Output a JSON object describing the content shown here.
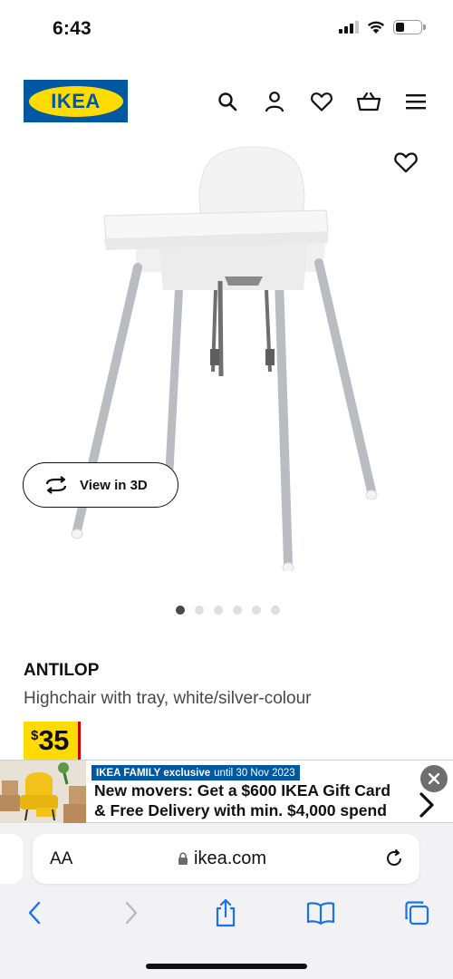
{
  "status_bar": {
    "time": "6:43",
    "icons": [
      "cellular-signal-icon",
      "wifi-icon",
      "battery-icon"
    ],
    "battery_level": 0.35
  },
  "header": {
    "logo_text": "IKEA",
    "logo_colors": {
      "background": "#0058a3",
      "oval": "#ffdb00"
    },
    "icons": [
      "search-icon",
      "user-icon",
      "heart-icon",
      "basket-icon",
      "menu-icon"
    ]
  },
  "gallery": {
    "favourite_icon": "heart-icon",
    "view_3d_label": "View in 3D",
    "view_3d_icon": "rotate-3d-icon",
    "slide_count": 6,
    "active_slide": 1
  },
  "product": {
    "name": "ANTILOP",
    "description": "Highchair with tray, white/silver-colour",
    "price_currency": "$",
    "price_value": "35",
    "price_colors": {
      "tag": "#ffdb00",
      "accent": "#cc0008"
    }
  },
  "promo": {
    "tag_bold": "IKEA FAMILY exclusive",
    "tag_rest": "until 30 Nov 2023",
    "line1": "New movers: Get a $600 IKEA Gift Card",
    "line2": "& Free Delivery with min. $4,000 spend",
    "close_icon": "close-icon",
    "chevron_icon": "chevron-right-icon"
  },
  "browser": {
    "text_size_label": "AA",
    "url": "ikea.com",
    "lock_icon": "lock-icon",
    "reload_icon": "reload-icon",
    "toolbar_icons": [
      "back-icon",
      "forward-icon",
      "share-icon",
      "bookmarks-icon",
      "tabs-icon"
    ]
  }
}
